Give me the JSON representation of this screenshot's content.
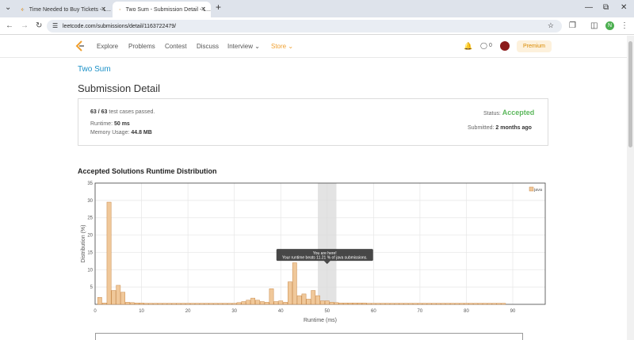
{
  "browser": {
    "tabs": [
      {
        "title": "Time Needed to Buy Tickets - L..."
      },
      {
        "title": "Two Sum - Submission Detail - L..."
      }
    ],
    "url": "leetcode.com/submissions/detail/1163722479/",
    "profile_initial": "N"
  },
  "nav": {
    "items": [
      "Explore",
      "Problems",
      "Contest",
      "Discuss",
      "Interview",
      "Store"
    ],
    "streak_count": "0",
    "premium_label": "Premium"
  },
  "page": {
    "problem_link": "Two Sum",
    "title": "Submission Detail",
    "tests_passed": "63 / 63",
    "tests_suffix": "test cases passed.",
    "status_label": "Status:",
    "status_value": "Accepted",
    "runtime_label": "Runtime:",
    "runtime_value": "50 ms",
    "memory_label": "Memory Usage:",
    "memory_value": "44.8 MB",
    "submitted_label": "Submitted:",
    "submitted_value": "2 months ago",
    "distribution_title": "Accepted Solutions Runtime Distribution"
  },
  "chart_data": {
    "type": "bar",
    "xlabel": "Runtime (ms)",
    "ylabel": "Distribution (%)",
    "xlim": [
      0,
      97
    ],
    "ylim": [
      0,
      35
    ],
    "xticks": [
      0,
      10,
      20,
      30,
      40,
      50,
      60,
      70,
      80,
      90
    ],
    "yticks": [
      5,
      10,
      15,
      20,
      25,
      30,
      35
    ],
    "legend": "java",
    "legend_position": "top-right",
    "grid": true,
    "bar_color": "#f0c89a",
    "highlight_range": [
      48,
      52
    ],
    "tooltip": {
      "line1": "You are here!",
      "line2": "Your runtime beats 11.21 % of java submissions."
    },
    "series": [
      {
        "name": "java",
        "x": [
          1,
          2,
          3,
          4,
          5,
          6,
          7,
          8,
          9,
          10,
          11,
          12,
          13,
          14,
          15,
          16,
          17,
          18,
          19,
          20,
          21,
          22,
          23,
          24,
          25,
          26,
          27,
          28,
          29,
          30,
          31,
          32,
          33,
          34,
          35,
          36,
          37,
          38,
          39,
          40,
          41,
          42,
          43,
          44,
          45,
          46,
          47,
          48,
          49,
          50,
          51,
          52,
          53,
          54,
          55,
          56,
          57,
          58,
          59,
          60,
          61,
          62,
          63,
          64,
          65,
          66,
          67,
          68,
          69,
          70,
          71,
          72,
          73,
          74,
          75,
          76,
          77,
          78,
          79,
          80,
          81,
          82,
          83,
          84,
          85,
          86,
          87,
          88
        ],
        "values": [
          2.0,
          0.4,
          29.5,
          4.0,
          5.5,
          3.5,
          0.6,
          0.5,
          0.4,
          0.4,
          0.3,
          0.3,
          0.3,
          0.3,
          0.3,
          0.3,
          0.3,
          0.3,
          0.3,
          0.3,
          0.3,
          0.3,
          0.3,
          0.3,
          0.3,
          0.3,
          0.3,
          0.3,
          0.3,
          0.3,
          0.5,
          0.8,
          1.2,
          1.8,
          1.2,
          0.8,
          0.6,
          4.5,
          0.8,
          1.0,
          0.6,
          6.5,
          12.0,
          2.5,
          3.0,
          1.5,
          4.0,
          2.5,
          1.0,
          1.0,
          0.6,
          0.5,
          0.4,
          0.4,
          0.4,
          0.4,
          0.4,
          0.4,
          0.3,
          0.3,
          0.3,
          0.3,
          0.3,
          0.3,
          0.3,
          0.3,
          0.3,
          0.3,
          0.3,
          0.3,
          0.3,
          0.3,
          0.3,
          0.3,
          0.3,
          0.3,
          0.3,
          0.3,
          0.3,
          0.3,
          0.3,
          0.3,
          0.3,
          0.3,
          0.3,
          0.3,
          0.3,
          0.3
        ]
      }
    ]
  }
}
